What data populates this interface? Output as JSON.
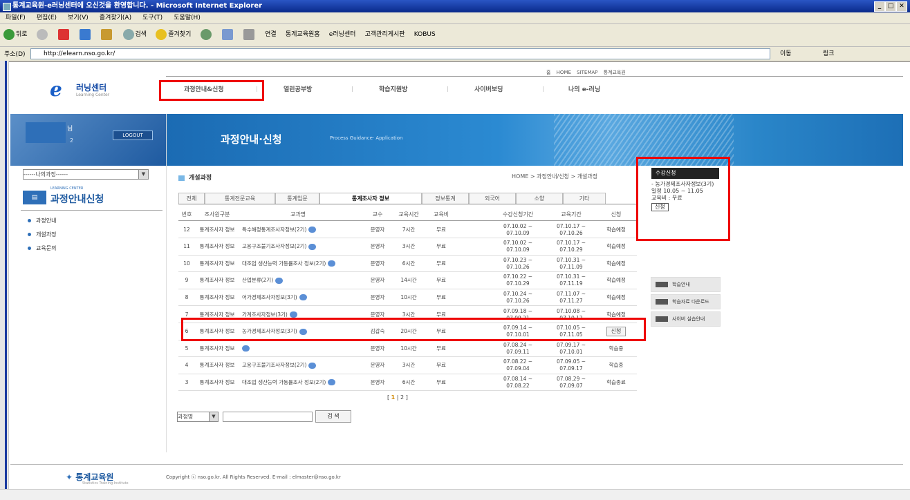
{
  "window": {
    "title": "통계교육원-e러닝센터에 오신것을 환영합니다. - Microsoft Internet Explorer",
    "menu": [
      "파일(F)",
      "편집(E)",
      "보기(V)",
      "즐겨찾기(A)",
      "도구(T)",
      "도움말(H)"
    ],
    "toolbar": {
      "back": "뒤로",
      "search": "검색",
      "favorites": "즐겨찾기",
      "links_label": "연결",
      "links": [
        "통계교육원홈",
        "e러닝센터",
        "고객관리게시판",
        "KOBUS"
      ]
    },
    "address": {
      "label": "주소(D)",
      "url": "http://elearn.nso.go.kr/",
      "go": "이동",
      "links": "링크"
    }
  },
  "header": {
    "utility": "홈 HOME  SITEMAP  통계교육원",
    "logo_title": "러닝센터",
    "logo_subtitle": "Learning Center",
    "gnav": [
      "과정안내&신청",
      "열린공부방",
      "학습지원방",
      "사이버보딩",
      "나의 e-러닝"
    ]
  },
  "left": {
    "user_suffix": "님",
    "count": "2",
    "logout": "LOGOUT",
    "my_course_select": "------나의과정------",
    "section_small": "LEARNING CENTER",
    "section_title": "과정안내신청",
    "menu": [
      "과정안내",
      "개설과정",
      "교육문의"
    ]
  },
  "banner": {
    "title": "과정안내·신청",
    "subtitle": "Process Guidance· Application"
  },
  "content": {
    "section_title": "개설과정",
    "breadcrumb": "HOME > 과정안내/신청 > 개설과정",
    "tabs": [
      "전체",
      "통계전문교육",
      "통계입문",
      "통계조사자 정보",
      "정보통계",
      "외국어",
      "소양",
      "기타"
    ],
    "columns": [
      "번호",
      "조사원구분",
      "교과명",
      "교수",
      "교육시간",
      "교육비",
      "수강신청기간",
      "교육기간",
      "신청"
    ],
    "rows": [
      {
        "no": "12",
        "type": "통계조사자 정보",
        "title": "특수해정통계조사자정보(2기)",
        "prof": "문영자",
        "hours": "7시간",
        "fee": "무료",
        "apply_period": "07.10.02 ~ 07.10.09",
        "study_period": "07.10.17 ~ 07.10.26",
        "status": "학습예정"
      },
      {
        "no": "11",
        "type": "통계조사자 정보",
        "title": "고용구조불기조사자정보(2기)",
        "prof": "문영자",
        "hours": "3시간",
        "fee": "무료",
        "apply_period": "07.10.02 ~ 07.10.09",
        "study_period": "07.10.17 ~ 07.10.29",
        "status": "학습예정"
      },
      {
        "no": "10",
        "type": "통계조사자 정보",
        "title": "대조업 생산능력 가동률조사 정보(2기)",
        "prof": "문영자",
        "hours": "6시간",
        "fee": "무료",
        "apply_period": "07.10.23 ~ 07.10.26",
        "study_period": "07.10.31 ~ 07.11.09",
        "status": "학습예정"
      },
      {
        "no": "9",
        "type": "통계조사자 정보",
        "title": "산업분류(2기)",
        "prof": "문영자",
        "hours": "14시간",
        "fee": "무료",
        "apply_period": "07.10.22 ~ 07.10.29",
        "study_period": "07.10.31 ~ 07.11.19",
        "status": "학습예정"
      },
      {
        "no": "8",
        "type": "통계조사자 정보",
        "title": "어가경제조사자정보(3기)",
        "prof": "문영자",
        "hours": "10시간",
        "fee": "무료",
        "apply_period": "07.10.24 ~ 07.10.26",
        "study_period": "07.11.07 ~ 07.11.27",
        "status": "학습예정"
      },
      {
        "no": "7",
        "type": "통계조사자 정보",
        "title": "가계조사자정보(3기)",
        "prof": "문영자",
        "hours": "3시간",
        "fee": "무료",
        "apply_period": "07.09.18 ~ 07.09.21",
        "study_period": "07.10.08 ~ 07.10.12",
        "status": "학습예정"
      },
      {
        "no": "6",
        "type": "통계조사자 정보",
        "title": "농가경제조사자정보(3기)",
        "prof": "김갑숙",
        "hours": "20시간",
        "fee": "무료",
        "apply_period": "07.09.14 ~ 07.10.01",
        "study_period": "07.10.05 ~ 07.11.05",
        "status": "신청"
      },
      {
        "no": "5",
        "type": "통계조사자 정보",
        "title": "",
        "prof": "문영자",
        "hours": "10시간",
        "fee": "무료",
        "apply_period": "07.08.24 ~ 07.09.11",
        "study_period": "07.09.17 ~ 07.10.01",
        "status": "학습중"
      },
      {
        "no": "4",
        "type": "통계조사자 정보",
        "title": "고용구조불기조사자정보(2기)",
        "prof": "문영자",
        "hours": "3시간",
        "fee": "무료",
        "apply_period": "07.08.22 ~ 07.09.04",
        "study_period": "07.09.05 ~ 07.09.17",
        "status": "학습중"
      },
      {
        "no": "3",
        "type": "통계조사자 정보",
        "title": "대조업 생산능력 가동률조사 정보(2기)",
        "prof": "문영자",
        "hours": "6시간",
        "fee": "무료",
        "apply_period": "07.08.14 ~ 07.08.22",
        "study_period": "07.08.29 ~ 07.09.07",
        "status": "학습종료"
      }
    ],
    "pager": {
      "prefix": "[",
      "current": "1",
      "sep": "|",
      "next": "2",
      "suffix": "]"
    },
    "search": {
      "select": "과정명",
      "button": "검 색"
    }
  },
  "quick": {
    "head": "수강신청",
    "course": "- 농가경제조사자정보(3기)",
    "date": "일정 10.05 ~ 11.05",
    "fee": "교육비 : 무료",
    "apply": "신청"
  },
  "sidebtns": [
    "학습안내",
    "학습자료 다운로드",
    "사이버 실습안내"
  ],
  "footer": {
    "logo": "통계교육원",
    "logo_sub": "Statistics Training Institute",
    "copyright": "Copyright ⓒ nso.go.kr. All Rights Reserved.     E-mail : elmaster@nso.go.kr"
  },
  "colors": {
    "highlight": "#e00000",
    "banner": "#1d6fb6",
    "accent": "#2e6fb8"
  }
}
